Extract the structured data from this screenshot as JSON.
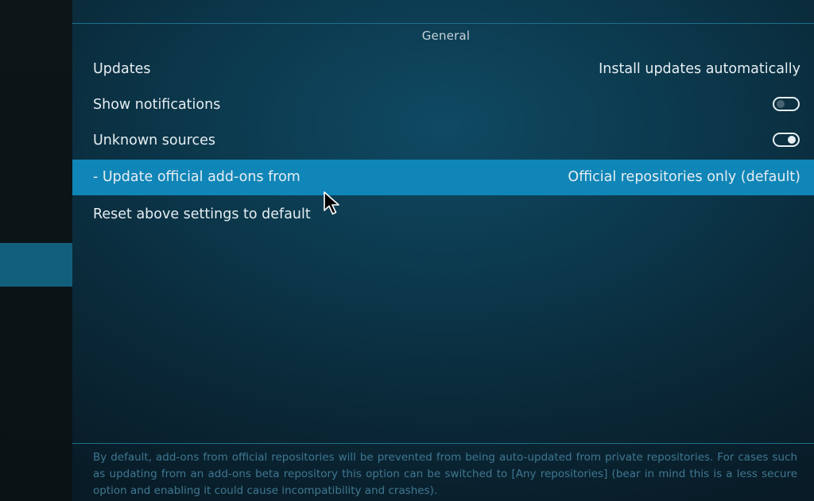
{
  "section": {
    "title": "General"
  },
  "settings": [
    {
      "label": "Updates",
      "value": "Install updates automatically"
    },
    {
      "label": "Show notifications",
      "toggle": "off"
    },
    {
      "label": "Unknown sources",
      "toggle": "on"
    },
    {
      "label": "- Update official add-ons from",
      "value": "Official repositories only (default)"
    },
    {
      "label": "Reset above settings to default"
    }
  ],
  "description": "By default, add-ons from official repositories will be prevented from being auto-updated from private repositories. For cases such as updating from an add-ons beta repository this option can be switched to [Any repositories] (bear in mind this is a less secure option and enabling it could cause incompatibility and crashes).",
  "colors": {
    "accent_selected": "#1085b7",
    "sidebar_selected": "#125f7c",
    "text": "#e6eef2",
    "description_text": "#3f7792"
  },
  "icons": {
    "cursor": "mouse-pointer-icon"
  }
}
